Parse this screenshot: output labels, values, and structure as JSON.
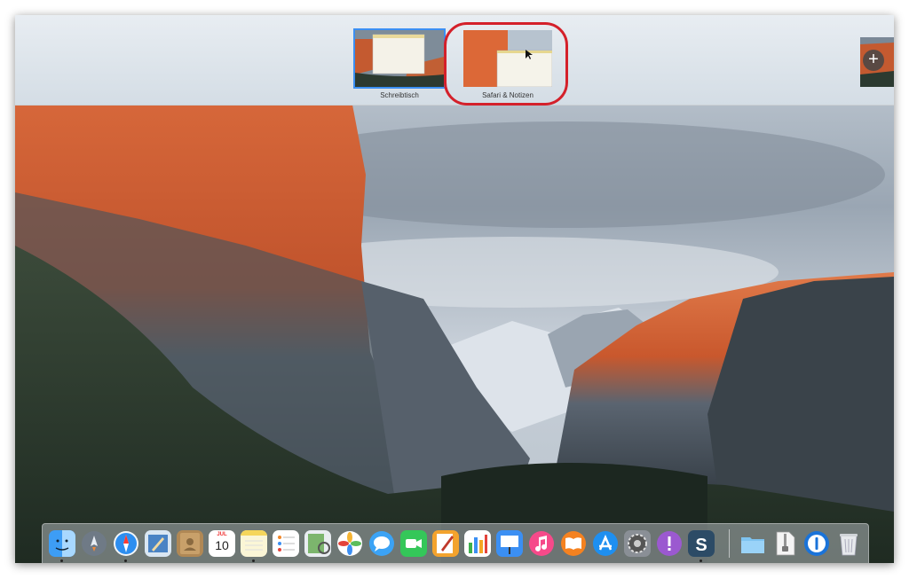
{
  "mission_control": {
    "spaces": [
      {
        "label": "Schreibtisch",
        "active": true
      },
      {
        "label": "Safari & Notizen",
        "active": false
      }
    ],
    "add_space_icon": "plus-icon",
    "highlight_color": "#d4202a",
    "active_outline_color": "#3b8ff3"
  },
  "dock": {
    "apps": [
      {
        "name": "finder-icon",
        "running": true
      },
      {
        "name": "launchpad-icon",
        "running": false
      },
      {
        "name": "safari-icon",
        "running": true
      },
      {
        "name": "mail-icon",
        "running": false
      },
      {
        "name": "contacts-icon",
        "running": false
      },
      {
        "name": "calendar-icon",
        "running": false,
        "month": "JUL",
        "day": "10"
      },
      {
        "name": "notes-icon",
        "running": true
      },
      {
        "name": "reminders-icon",
        "running": false
      },
      {
        "name": "preview-icon",
        "running": false
      },
      {
        "name": "photos-icon",
        "running": false
      },
      {
        "name": "messages-icon",
        "running": false
      },
      {
        "name": "facetime-icon",
        "running": false
      },
      {
        "name": "pages-icon",
        "running": false
      },
      {
        "name": "numbers-icon",
        "running": false
      },
      {
        "name": "keynote-icon",
        "running": false
      },
      {
        "name": "itunes-icon",
        "running": false
      },
      {
        "name": "ibooks-icon",
        "running": false
      },
      {
        "name": "app-store-icon",
        "running": false
      },
      {
        "name": "system-preferences-icon",
        "running": false
      },
      {
        "name": "feedback-icon",
        "running": false
      },
      {
        "name": "snagit-icon",
        "running": true
      },
      {
        "name": "downloads-folder-icon",
        "running": false
      },
      {
        "name": "archive-icon",
        "running": false
      },
      {
        "name": "1password-icon",
        "running": false
      },
      {
        "name": "trash-icon",
        "running": false
      }
    ]
  }
}
